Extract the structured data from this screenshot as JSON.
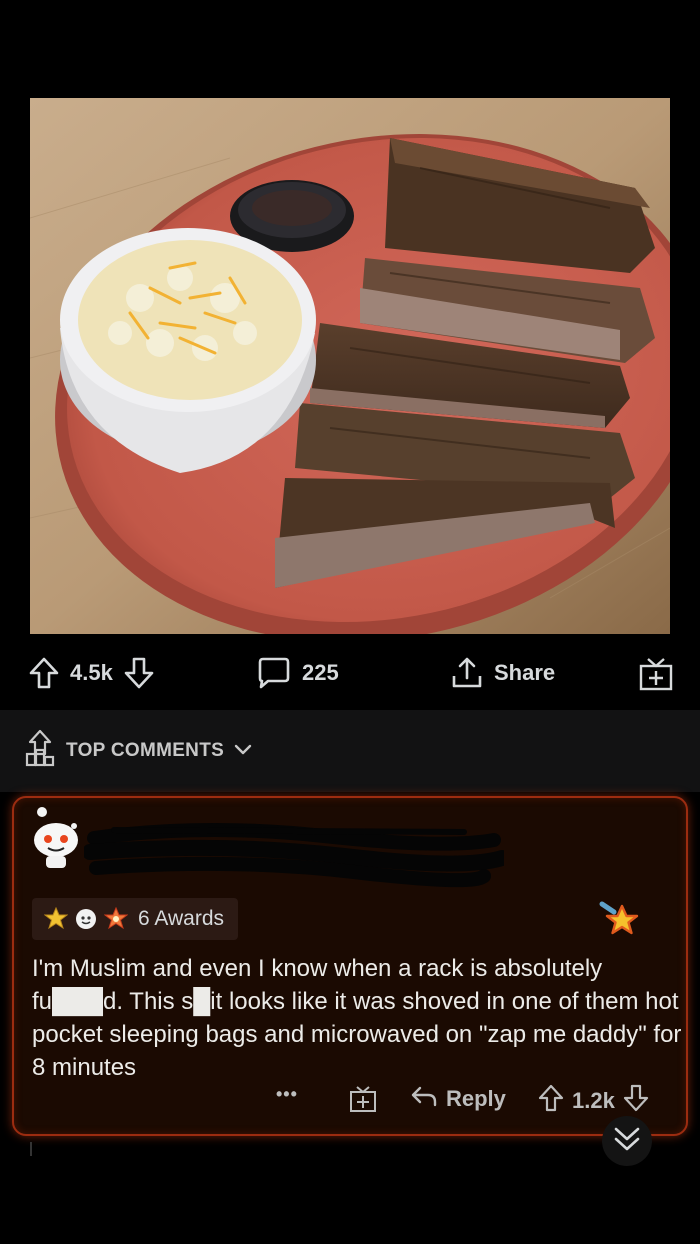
{
  "post": {
    "image_alt": "Plate of ribs with mac and cheese",
    "upvotes": "4.5k",
    "comments_count": "225",
    "share_label": "Share"
  },
  "comments_header": {
    "sort_label": "TOP COMMENTS"
  },
  "comment": {
    "awards_label": "6 Awards",
    "body": "I'm Muslim and even I know when a rack is absolutely fu███d. This s█it looks like it was shoved in one of them hot pocket sleeping bags and microwaved on \"zap me daddy\" for 8 minutes",
    "more_label": "•••",
    "reply_label": "Reply",
    "votes": "1.2k"
  },
  "colors": {
    "background": "#000000",
    "card_border": "#9c2c10",
    "card_bg": "#1b0a02",
    "plate": "#c75a4a"
  }
}
